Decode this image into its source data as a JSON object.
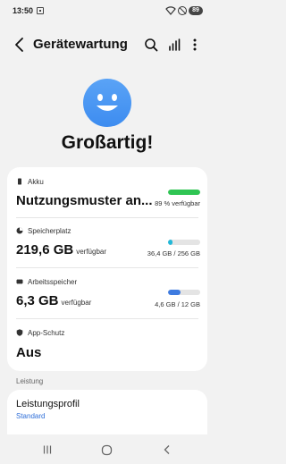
{
  "status_bar": {
    "time": "13:50",
    "battery": "89",
    "icons": [
      "screenshot-icon",
      "wifi-icon",
      "do-not-disturb-icon",
      "battery-icon"
    ]
  },
  "header": {
    "title": "Gerätewartung",
    "icons": [
      "back-arrow-icon",
      "search-icon",
      "stats-icon",
      "more-vertical-icon"
    ]
  },
  "hero": {
    "status_text": "Großartig!",
    "face_color": "#3d8cf0"
  },
  "items": [
    {
      "label": "Akku",
      "value": "Nutzungsmuster an...",
      "value_suffix": "",
      "caption": "89 % verfügbar",
      "bar_fraction": 1.0,
      "bar_color": "#2fc553",
      "icon": "battery-icon"
    },
    {
      "label": "Speicherplatz",
      "value": "219,6 GB",
      "value_suffix": "verfügbar",
      "caption": "36,4 GB / 256 GB",
      "bar_fraction": 0.142,
      "bar_color": "#22b8d8",
      "icon": "storage-icon"
    },
    {
      "label": "Arbeitsspeicher",
      "value": "6,3 GB",
      "value_suffix": "verfügbar",
      "caption": "4,6 GB / 12 GB",
      "bar_fraction": 0.383,
      "bar_color": "#3e7be0",
      "icon": "memory-icon"
    },
    {
      "label": "App-Schutz",
      "value": "Aus",
      "value_suffix": "",
      "caption": "",
      "icon": "shield-icon"
    }
  ],
  "section": {
    "label": "Leistung",
    "item_title": "Leistungsprofil",
    "item_subtitle": "Standard"
  },
  "nav_bar": [
    "recents-icon",
    "home-icon",
    "back-icon"
  ],
  "colors": {
    "background": "#f2f2f2",
    "card": "#ffffff",
    "link": "#2e6ed8"
  }
}
